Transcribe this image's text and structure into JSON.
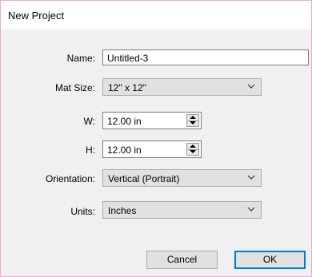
{
  "dialog": {
    "title": "New Project"
  },
  "form": {
    "name": {
      "label": "Name:",
      "value": "Untitled-3"
    },
    "mat_size": {
      "label": "Mat Size:",
      "value": "12\" x 12\""
    },
    "width": {
      "label": "W:",
      "value": "12.00 in"
    },
    "height": {
      "label": "H:",
      "value": "12.00 in"
    },
    "orientation": {
      "label": "Orientation:",
      "value": "Vertical (Portrait)"
    },
    "units": {
      "label": "Units:",
      "value": "Inches"
    }
  },
  "buttons": {
    "cancel": "Cancel",
    "ok": "OK"
  },
  "colors": {
    "dialog_border": "#e8a8d8",
    "dialog_bg": "#f0f0f0",
    "default_button_border": "#0078d7"
  },
  "icons": {
    "dropdown": "chevron-down-icon",
    "spin": "spin-up-down-icon"
  }
}
